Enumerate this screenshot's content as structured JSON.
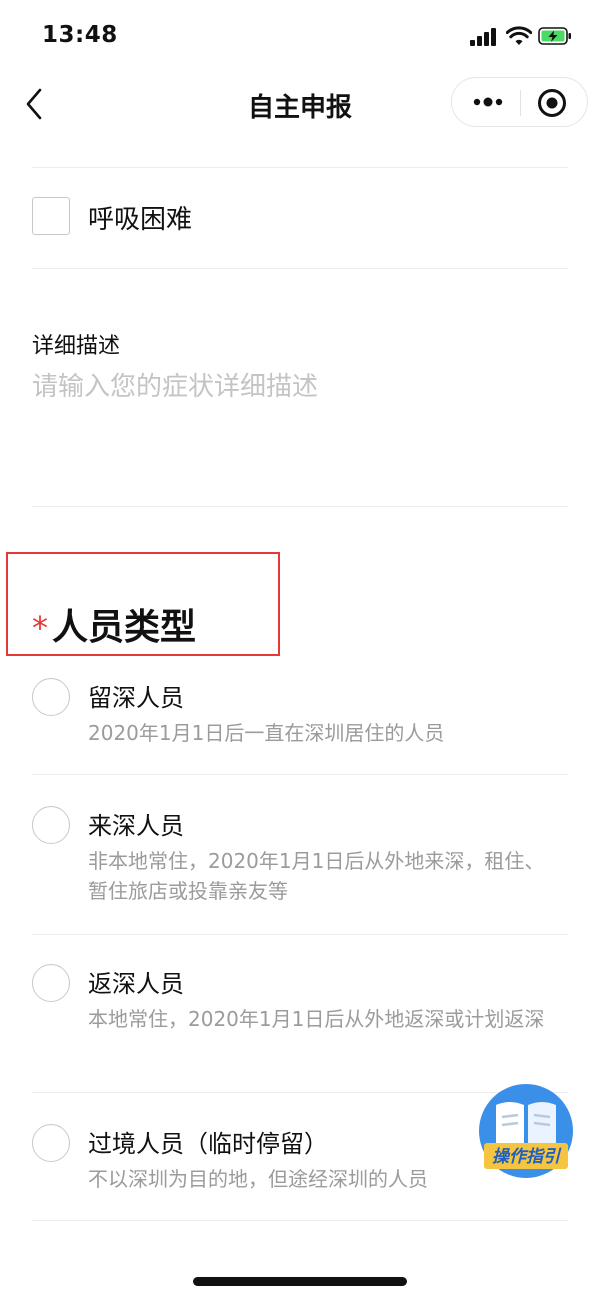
{
  "status_bar": {
    "time": "13:48"
  },
  "nav": {
    "title": "自主申报"
  },
  "symptoms": {
    "breathing_difficulty_label": "呼吸困难"
  },
  "description": {
    "label": "详细描述",
    "placeholder": "请输入您的症状详细描述"
  },
  "person_type": {
    "required_mark": "*",
    "title": "人员类型",
    "options": [
      {
        "title": "留深人员",
        "desc": "2020年1月1日后一直在深圳居住的人员"
      },
      {
        "title": "来深人员",
        "desc": "非本地常住，2020年1月1日后从外地来深，租住、暂住旅店或投靠亲友等"
      },
      {
        "title": "返深人员",
        "desc": "本地常住，2020年1月1日后从外地返深或计划返深"
      },
      {
        "title": "过境人员（临时停留）",
        "desc": "不以深圳为目的地，但途经深圳的人员"
      }
    ]
  },
  "guide": {
    "label": "操作指引"
  },
  "colors": {
    "required": "#e53935",
    "highlight_border": "#e53935",
    "battery": "#4cd964",
    "guide_blue": "#3a8fe8",
    "guide_yellow": "#f5c542"
  }
}
